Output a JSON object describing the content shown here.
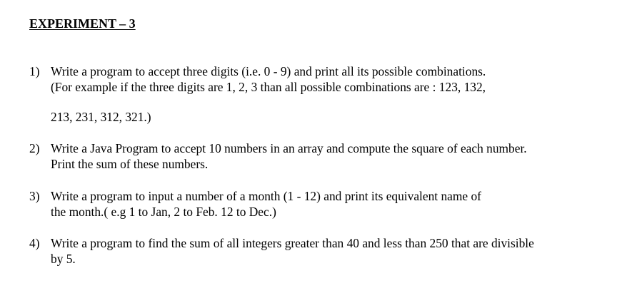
{
  "title": "EXPERIMENT – 3",
  "items": [
    {
      "number": "1)",
      "lines": [
        "Write a program to accept three digits (i.e. 0 - 9) and print all its possible combinations.",
        "(For example if the three digits are 1, 2, 3 than all possible combinations are : 123, 132,",
        "213, 231, 312, 321.)"
      ]
    },
    {
      "number": "2)",
      "lines": [
        "Write a Java Program to accept 10 numbers in an array and compute the square of each number.",
        "Print the sum of these numbers."
      ]
    },
    {
      "number": "3)",
      "lines": [
        "Write a program to input a number of a month (1 - 12) and print its equivalent name of",
        "the month.( e.g 1 to Jan, 2 to Feb. 12 to Dec.)"
      ]
    },
    {
      "number": "4)",
      "lines": [
        "Write a program to find the sum of all integers greater than 40 and less than 250 that are divisible",
        "by 5."
      ]
    }
  ]
}
